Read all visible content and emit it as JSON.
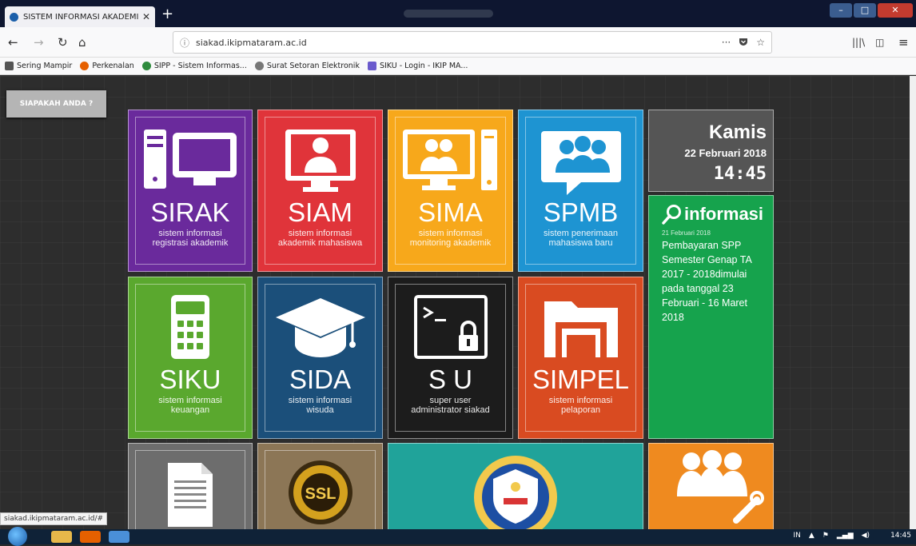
{
  "browser": {
    "tab_title": "SISTEM INFORMASI AKADEMIK",
    "tab_close": "✕",
    "new_tab": "+",
    "url": "siakad.ikipmataram.ac.id",
    "url_info_icon": "info-icon",
    "url_actions": [
      "···",
      "pocket-icon",
      "☆"
    ],
    "bookmarks": [
      {
        "label": "Sering Mampir",
        "icon": "gear-icon",
        "color": "#555555"
      },
      {
        "label": "Perkenalan",
        "icon": "firefox-icon",
        "color": "#e66000"
      },
      {
        "label": "SIPP - Sistem Informas...",
        "icon": "sipp-icon",
        "color": "#2e8b3d"
      },
      {
        "label": "Surat Setoran Elektronik",
        "icon": "globe-icon",
        "color": "#777777"
      },
      {
        "label": "SIKU - Login - IKIP MA...",
        "icon": "siku-icon",
        "color": "#6a5acd"
      }
    ],
    "status_url": "siakad.ikipmataram.ac.id/#"
  },
  "page": {
    "who_button": "SIAPAKAH ANDA ?",
    "tiles": {
      "sirak": {
        "name": "SIRAK",
        "sub1": "sistem informasi",
        "sub2": "registrasi akademik",
        "color": "#6a2a9c"
      },
      "siam": {
        "name": "SIAM",
        "sub1": "sistem informasi",
        "sub2": "akademik mahasiswa",
        "color": "#e0343a"
      },
      "sima": {
        "name": "SIMA",
        "sub1": "sistem informasi",
        "sub2": "monitoring akademik",
        "color": "#f7a81b"
      },
      "spmb": {
        "name": "SPMB",
        "sub1": "sistem penerimaan",
        "sub2": "mahasiswa baru",
        "color": "#1e94d2"
      },
      "siku": {
        "name": "SIKU",
        "sub1": "sistem informasi",
        "sub2": "keuangan",
        "color": "#5aa82e"
      },
      "sida": {
        "name": "SIDA",
        "sub1": "sistem informasi",
        "sub2": "wisuda",
        "color": "#1b4f7a"
      },
      "su": {
        "name": "S U",
        "sub1": "super user",
        "sub2": "administrator siakad",
        "color": "#1c1c1c"
      },
      "simpel": {
        "name": "SIMPEL",
        "sub1": "sistem informasi",
        "sub2": "pelaporan",
        "color": "#d94b21"
      }
    },
    "datetime": {
      "day": "Kamis",
      "date": "22 Februari 2018",
      "time": "14:45"
    },
    "info": {
      "title": "informasi",
      "date": "21 Februari 2018",
      "message": "Pembayaran SPP Semester Genap TA 2017 - 2018dimulai pada tanggal 23 Februari - 16 Maret 2018"
    },
    "ssl_label": "SSL"
  },
  "taskbar": {
    "lang": "IN",
    "clock": "14:45"
  }
}
